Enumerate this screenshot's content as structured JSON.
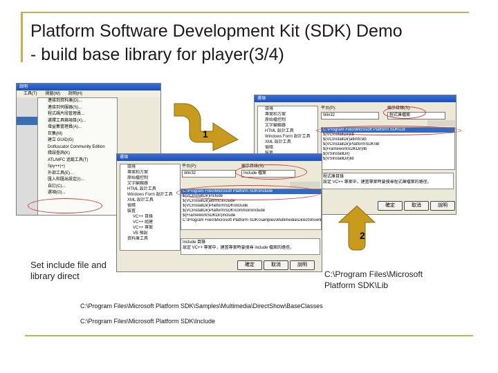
{
  "slide": {
    "title_line1": "Platform Software Development Kit (SDK) Demo",
    "title_line2": "- build base library for player(3/4)",
    "note_left_line1": "Set include file and",
    "note_left_line2": "library direct",
    "note_right_line1": "C:\\Program Files\\Microsoft",
    "note_right_line2": "Platform SDK\\Lib",
    "path_samples": "C:\\Program Files\\Microsoft Platform SDK\\Samples\\Multimedia\\DirectShow\\BaseClasses",
    "path_include": "C:\\Program Files\\Microsoft Platform SDK\\Include",
    "step1": "1",
    "step2": "2"
  },
  "colors": {
    "accent": "#c8b050",
    "arrow": "#c89b1c",
    "highlight": "#d43a3a",
    "selection": "#316ac5"
  },
  "ide_window": {
    "caption": "說明",
    "menu_items": [
      "工具(T)",
      "視窗(W)",
      "說明(H)"
    ],
    "tools_menu": [
      "連接到資料庫(D)...",
      "連接到伺服器(S)...",
      "程式碼片段管理員...",
      "選擇工具箱項目(X)...",
      "增益集管理員(A)...",
      "巨集(M)",
      "建立 GUID(G)",
      "Dotfuscator Community Edition",
      "錯誤查詢(K)",
      "ATL/MFC 追蹤工具(T)",
      "Spy++(+)",
      "外部工具(E)...",
      "匯入和匯出設定(I)...",
      "自訂(C)...",
      "選項(O)..."
    ]
  },
  "options_dialog_front": {
    "caption": "選項",
    "tree_items": [
      "環境",
      "專案和方案",
      "原始檔控制",
      "文字編輯器",
      "HTML 設計工具",
      "Windows Form 設計工具",
      "XML 設計工具",
      "偵錯",
      "裝置",
      "VC++ 目錄",
      "VC++ 組建",
      "VC++ 專案",
      "VB 預設",
      "資料庫工具"
    ],
    "platform_label": "平台(P):",
    "platform_value": "Win32",
    "dirs_label": "顯示目錄(S):",
    "dirs_value": "Include 檔案",
    "paths": [
      "C:\\Program Files\\Microsoft Platform SDK\\Include",
      "$(VCInstallDir)include",
      "$(VCInstallDir)atlmfc\\include",
      "$(VCInstallDir)PlatformSDK\\include",
      "$(VCInstallDir)PlatformSDK\\common\\include",
      "$(FrameworkSDKDir)include",
      "C:\\Program Files\\Microsoft Platform SDK\\Samples\\Multimedia\\DirectShow\\BaseClasses"
    ],
    "desc_title": "Include 目錄",
    "desc_text": "設定 VC++ 專案中，建置專案時要搜尋 include 檔案的路徑。",
    "buttons": [
      "確定",
      "取消",
      "說明"
    ]
  },
  "options_dialog_back": {
    "caption": "選項",
    "tree_items": [
      "環境",
      "專案和方案",
      "原始檔控制",
      "文字編輯器",
      "HTML 設計工具",
      "Windows Form 設計工具",
      "XML 設計工具",
      "偵錯",
      "裝置"
    ],
    "platform_label": "平台(P):",
    "platform_value": "Win32",
    "dirs_label": "顯示目錄(S):",
    "dirs_value": "程式庫檔案",
    "paths": [
      "C:\\Program Files\\Microsoft Platform SDK\\Lib",
      "$(VCInstallDir)lib",
      "$(VCInstallDir)atlmfc\\lib",
      "$(VCInstallDir)PlatformSDK\\lib",
      "$(FrameworkSDKDir)lib",
      "$(VSInstallDir)",
      "$(VSInstallDir)lib"
    ],
    "desc_title": "程式庫目錄",
    "desc_text": "設定 VC++ 專案中，建置專案時要搜尋程式庫檔案的路徑。",
    "buttons": [
      "確定",
      "取消",
      "說明"
    ]
  }
}
